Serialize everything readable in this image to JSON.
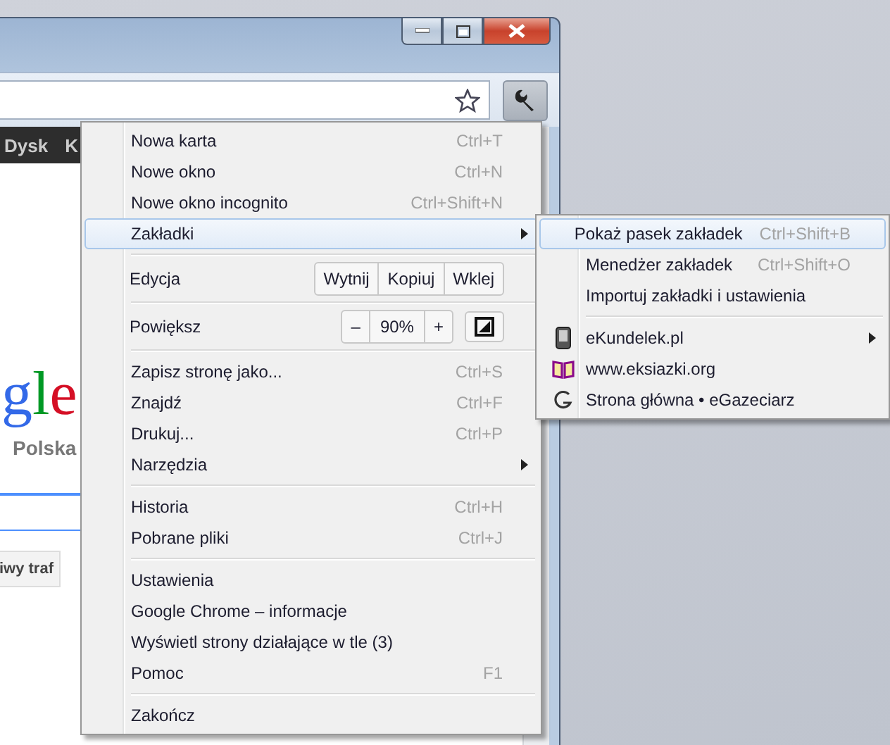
{
  "page": {
    "nav_links": [
      "Dysk",
      "K"
    ],
    "logo": "gle",
    "logo_subtitle": "Polska",
    "search_button": "iwy traf"
  },
  "menu": [
    {
      "kind": "item",
      "label": "Nowa karta",
      "shortcut": "Ctrl+T",
      "submenu": false,
      "selected": false
    },
    {
      "kind": "item",
      "label": "Nowe okno",
      "shortcut": "Ctrl+N",
      "submenu": false,
      "selected": false
    },
    {
      "kind": "item",
      "label": "Nowe okno incognito",
      "shortcut": "Ctrl+Shift+N",
      "submenu": false,
      "selected": false
    },
    {
      "kind": "item",
      "label": "Zakładki",
      "submenu": true,
      "selected": true
    },
    {
      "kind": "separator"
    },
    {
      "kind": "edit",
      "label": "Edycja",
      "buttons": [
        "Wytnij",
        "Kopiuj",
        "Wklej"
      ]
    },
    {
      "kind": "separator"
    },
    {
      "kind": "zoom",
      "label": "Powiększ",
      "minus": "–",
      "value": "90%",
      "plus": "+"
    },
    {
      "kind": "separator"
    },
    {
      "kind": "item",
      "label": "Zapisz stronę jako...",
      "shortcut": "Ctrl+S",
      "submenu": false,
      "selected": false
    },
    {
      "kind": "item",
      "label": "Znajdź",
      "shortcut": "Ctrl+F",
      "submenu": false,
      "selected": false
    },
    {
      "kind": "item",
      "label": "Drukuj...",
      "shortcut": "Ctrl+P",
      "submenu": false,
      "selected": false
    },
    {
      "kind": "item",
      "label": "Narzędzia",
      "submenu": true,
      "selected": false
    },
    {
      "kind": "separator"
    },
    {
      "kind": "item",
      "label": "Historia",
      "shortcut": "Ctrl+H",
      "submenu": false,
      "selected": false
    },
    {
      "kind": "item",
      "label": "Pobrane pliki",
      "shortcut": "Ctrl+J",
      "submenu": false,
      "selected": false
    },
    {
      "kind": "separator"
    },
    {
      "kind": "item",
      "label": "Ustawienia",
      "submenu": false,
      "selected": false
    },
    {
      "kind": "item",
      "label": "Google Chrome – informacje",
      "submenu": false,
      "selected": false
    },
    {
      "kind": "item",
      "label": "Wyświetl strony działające w tle (3)",
      "submenu": false,
      "selected": false
    },
    {
      "kind": "item",
      "label": "Pomoc",
      "shortcut": "F1",
      "submenu": false,
      "selected": false
    },
    {
      "kind": "separator"
    },
    {
      "kind": "item",
      "label": "Zakończ",
      "submenu": false,
      "selected": false
    }
  ],
  "bookmarks_menu": [
    {
      "kind": "item",
      "label": "Pokaż pasek zakładek",
      "shortcut": "Ctrl+Shift+B",
      "submenu": false,
      "selected": true
    },
    {
      "kind": "item",
      "label": "Menedżer zakładek",
      "shortcut": "Ctrl+Shift+O",
      "submenu": false,
      "selected": false
    },
    {
      "kind": "item",
      "label": "Importuj zakładki i ustawienia",
      "submenu": false,
      "selected": false
    },
    {
      "kind": "separator"
    },
    {
      "kind": "bookmark",
      "label": "eKundelek.pl",
      "submenu": true,
      "selected": false
    },
    {
      "kind": "bookmark",
      "label": "www.eksiazki.org",
      "submenu": false,
      "selected": false
    },
    {
      "kind": "bookmark",
      "label": "Strona główna • eGazeciarz",
      "submenu": false,
      "selected": false
    }
  ]
}
